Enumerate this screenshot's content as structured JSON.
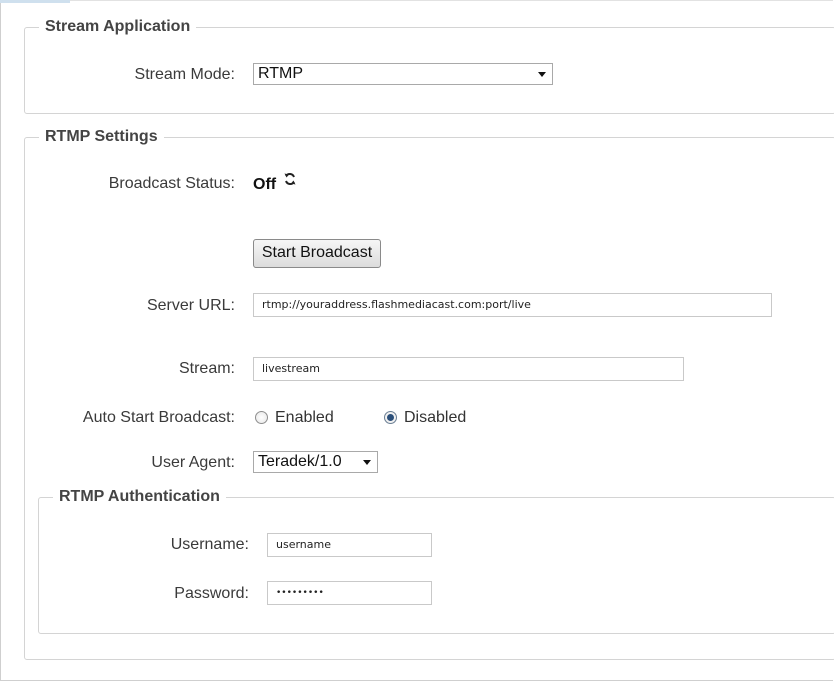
{
  "stream_application": {
    "legend": "Stream Application",
    "stream_mode_label": "Stream Mode:",
    "stream_mode_value": "RTMP"
  },
  "rtmp_settings": {
    "legend": "RTMP Settings",
    "broadcast_status_label": "Broadcast Status:",
    "broadcast_status_value": "Off",
    "refresh_icon": "refresh-icon",
    "start_button_label": "Start Broadcast",
    "server_url_label": "Server URL:",
    "server_url_value": "rtmp://youraddress.flashmediacast.com:port/live",
    "stream_label": "Stream:",
    "stream_value": "livestream",
    "auto_start_label": "Auto Start Broadcast:",
    "auto_start_options": [
      {
        "label": "Enabled",
        "checked": false
      },
      {
        "label": "Disabled",
        "checked": true
      }
    ],
    "user_agent_label": "User Agent:",
    "user_agent_value": "Teradek/1.0"
  },
  "rtmp_authentication": {
    "legend": "RTMP Authentication",
    "username_label": "Username:",
    "username_value": "username",
    "password_label": "Password:",
    "password_value": "•••••••••"
  }
}
